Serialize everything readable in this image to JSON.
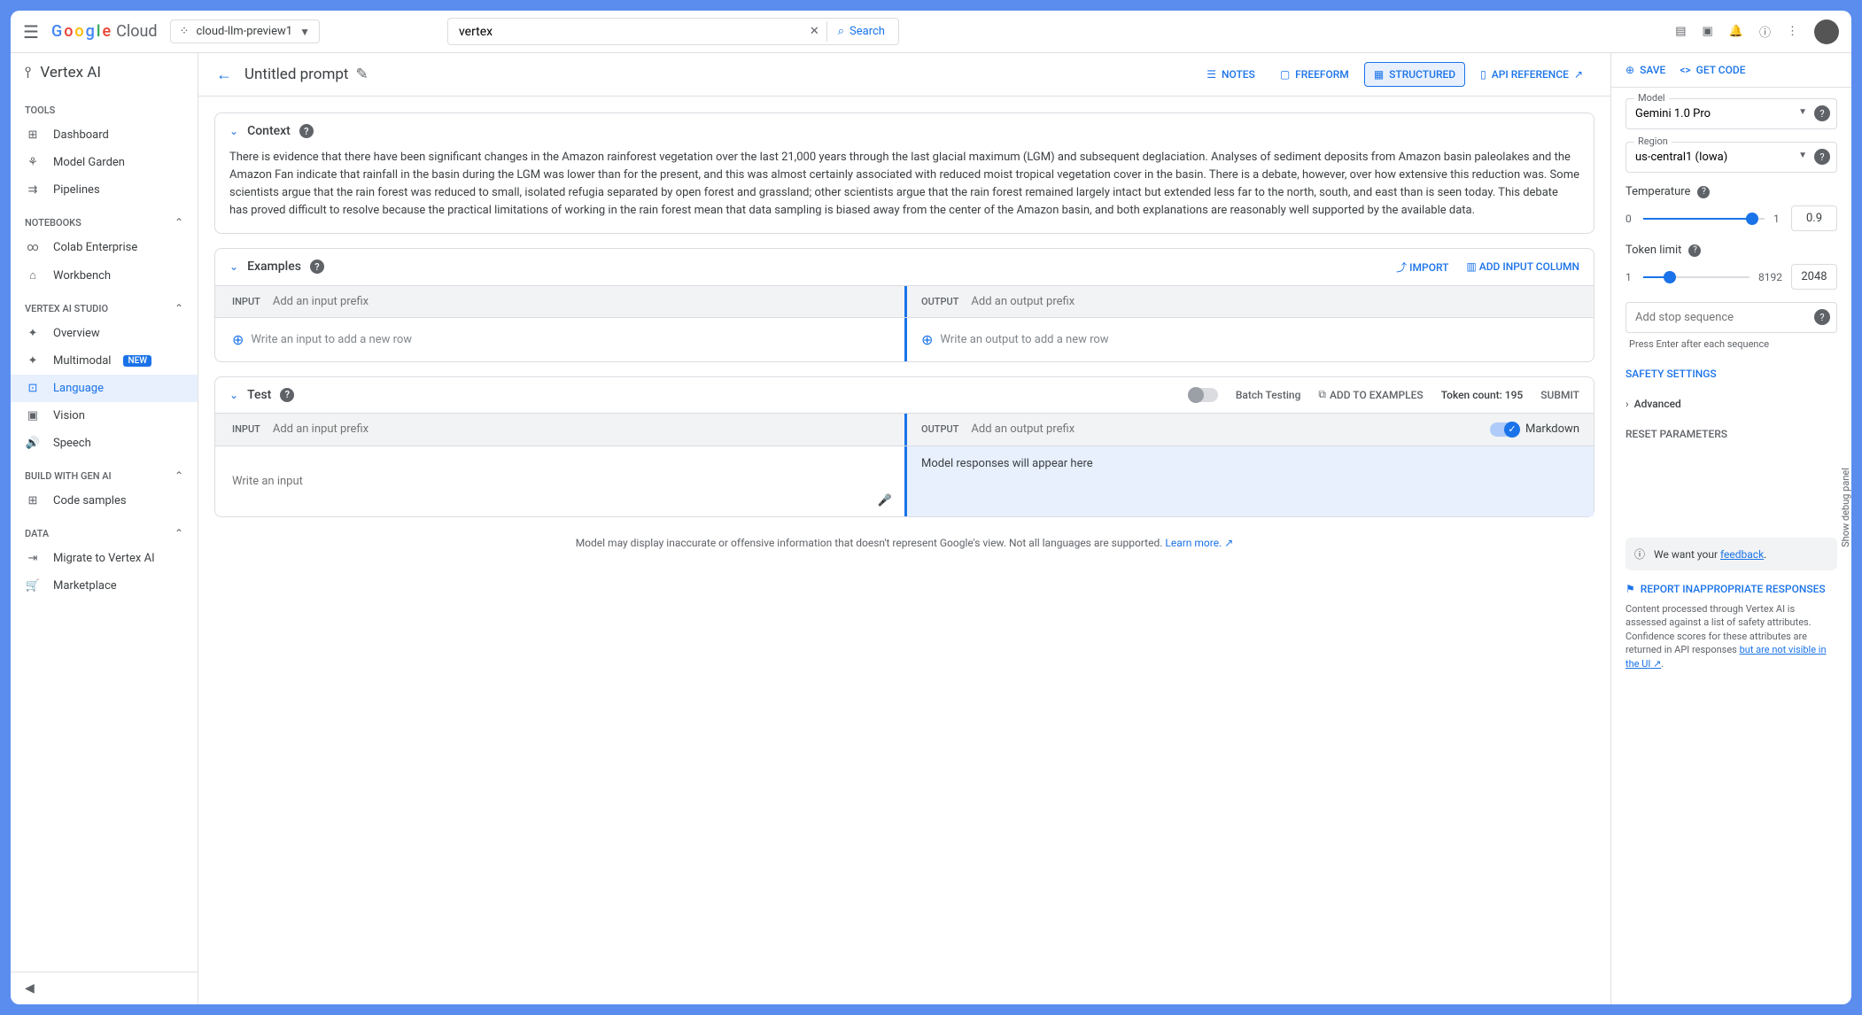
{
  "topbar": {
    "logo": "Google Cloud",
    "project": "cloud-llm-preview1",
    "search_value": "vertex",
    "search_button": "Search"
  },
  "sidebar": {
    "product": "Vertex AI",
    "sections": {
      "tools": {
        "label": "TOOLS",
        "items": [
          {
            "label": "Dashboard"
          },
          {
            "label": "Model Garden"
          },
          {
            "label": "Pipelines"
          }
        ]
      },
      "notebooks": {
        "label": "NOTEBOOKS",
        "items": [
          {
            "label": "Colab Enterprise"
          },
          {
            "label": "Workbench"
          }
        ]
      },
      "studio": {
        "label": "VERTEX AI STUDIO",
        "items": [
          {
            "label": "Overview"
          },
          {
            "label": "Multimodal",
            "badge": "NEW"
          },
          {
            "label": "Language",
            "active": true
          },
          {
            "label": "Vision"
          },
          {
            "label": "Speech"
          }
        ]
      },
      "build": {
        "label": "BUILD WITH GEN AI",
        "items": [
          {
            "label": "Code samples"
          }
        ]
      },
      "data": {
        "label": "DATA",
        "items": [
          {
            "label": "Migrate to Vertex AI"
          },
          {
            "label": "Marketplace"
          }
        ]
      }
    }
  },
  "page": {
    "title": "Untitled prompt",
    "tabs": {
      "notes": "NOTES",
      "freeform": "FREEFORM",
      "structured": "STRUCTURED",
      "api": "API REFERENCE"
    }
  },
  "context": {
    "title": "Context",
    "text": "There is evidence that there have been significant changes in the Amazon rainforest vegetation over the last 21,000 years through the last glacial maximum (LGM) and subsequent deglaciation. Analyses of sediment deposits from Amazon basin paleolakes and the Amazon Fan indicate that rainfall in the basin during the LGM was lower than for the present, and this was almost certainly associated with reduced moist tropical vegetation cover in the basin. There is a debate, however, over how extensive this reduction was. Some scientists argue that the rain forest was reduced to small, isolated refugia separated by open forest and grassland; other scientists argue that the rain forest remained largely intact but extended less far to the north, south, and east than is seen today. This debate has proved difficult to resolve because the practical limitations of working in the rain forest mean that data sampling is biased away from the center of the Amazon basin, and both explanations are reasonably well supported by the available data."
  },
  "examples": {
    "title": "Examples",
    "import": "IMPORT",
    "add_col": "ADD INPUT COLUMN",
    "input_label": "INPUT",
    "output_label": "OUTPUT",
    "input_prefix_placeholder": "Add an input prefix",
    "output_prefix_placeholder": "Add an output prefix",
    "input_row_placeholder": "Write an input to add a new row",
    "output_row_placeholder": "Write an output to add a new row"
  },
  "test": {
    "title": "Test",
    "batch": "Batch Testing",
    "add_ex": "ADD TO EXAMPLES",
    "token_count": "Token count: 195",
    "submit": "SUBMIT",
    "input_label": "INPUT",
    "output_label": "OUTPUT",
    "input_prefix_placeholder": "Add an input prefix",
    "output_prefix_placeholder": "Add an output prefix",
    "markdown": "Markdown",
    "input_placeholder": "Write an input",
    "response_placeholder": "Model responses will appear here"
  },
  "disclaimer": {
    "text": "Model may display inaccurate or offensive information that doesn't represent Google's view. Not all languages are supported. ",
    "link": "Learn more."
  },
  "right": {
    "save": "SAVE",
    "get_code": "GET CODE",
    "model": {
      "label": "Model",
      "value": "Gemini 1.0 Pro"
    },
    "region": {
      "label": "Region",
      "value": "us-central1 (Iowa)"
    },
    "temperature": {
      "label": "Temperature",
      "min": "0",
      "max": "1",
      "value": "0.9",
      "pct": 90
    },
    "token_limit": {
      "label": "Token limit",
      "min": "1",
      "max": "8192",
      "value": "2048",
      "pct": 25
    },
    "stop": {
      "placeholder": "Add stop sequence",
      "hint": "Press Enter after each sequence"
    },
    "safety": "SAFETY SETTINGS",
    "advanced": "Advanced",
    "reset": "RESET PARAMETERS",
    "feedback": {
      "prefix": "We want your ",
      "link": "feedback"
    },
    "report": "REPORT INAPPROPRIATE RESPONSES",
    "policy": {
      "text": "Content processed through Vertex AI is assessed against a list of safety attributes. Confidence scores for these attributes are returned in API responses ",
      "link": "but are not visible in the UI"
    }
  },
  "debug_panel": "Show debug panel"
}
